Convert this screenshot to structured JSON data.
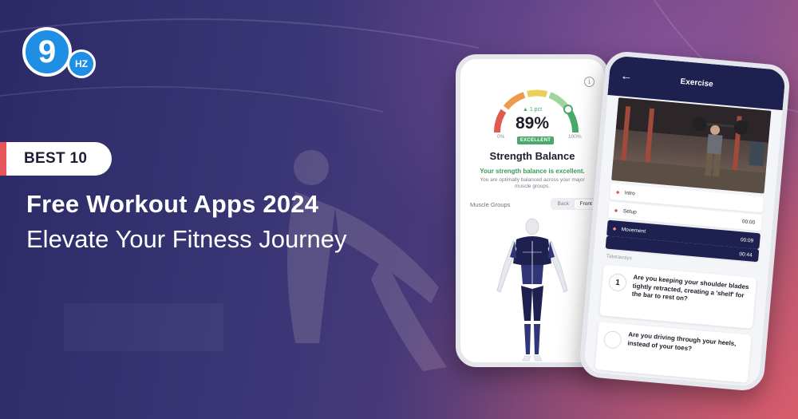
{
  "logo": {
    "main": "9",
    "badge": "HZ"
  },
  "promo": {
    "pill": "BEST 10",
    "headline": "Free Workout Apps 2024",
    "subline": "Elevate Your Fitness Journey"
  },
  "strength_screen": {
    "gauge_delta": "▲ 1 pct",
    "gauge_value": "89%",
    "gauge_min": "0%",
    "gauge_max": "100%",
    "gauge_badge": "EXCELLENT",
    "title": "Strength Balance",
    "status": "Your strength balance is excellent.",
    "description": "You are optimally balanced across your major muscle groups.",
    "muscle_groups_label": "Muscle Groups",
    "toggle_back": "Back",
    "toggle_front": "Front",
    "colors": {
      "gauge_red": "#e05a4f",
      "gauge_orange": "#ee9a4a",
      "gauge_yellow": "#eccf5a",
      "gauge_light_green": "#9fd59a",
      "gauge_green": "#4aa86a",
      "muscle_navy": "#1e2150"
    }
  },
  "exercise_screen": {
    "title": "Exercise",
    "sections": [
      {
        "label": "Intro",
        "time": ""
      },
      {
        "label": "Setup",
        "time": "00:00"
      },
      {
        "label": "Movement",
        "time": "00:09"
      },
      {
        "label": "",
        "time": "00:44"
      }
    ],
    "takeaways_label": "Takeaways",
    "questions": [
      {
        "num": "1",
        "text": "Are you keeping your shoulder blades tightly retracted, creating a 'shelf' for the bar to rest on?"
      },
      {
        "num": "",
        "text": "Are you driving through your heels, instead of your toes?"
      }
    ],
    "colors": {
      "header": "#1e2150",
      "accent": "#e05a5a"
    }
  },
  "icons": [
    "info-icon",
    "back-arrow-icon",
    "muscle-body-icon"
  ]
}
